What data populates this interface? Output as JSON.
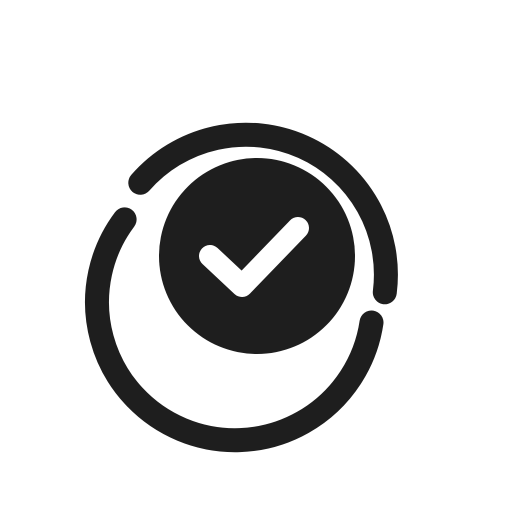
{
  "icon": {
    "name": "verified-check-icon",
    "color": "#1e1e1e",
    "check_color": "#ffffff",
    "background": "#ffffff"
  }
}
